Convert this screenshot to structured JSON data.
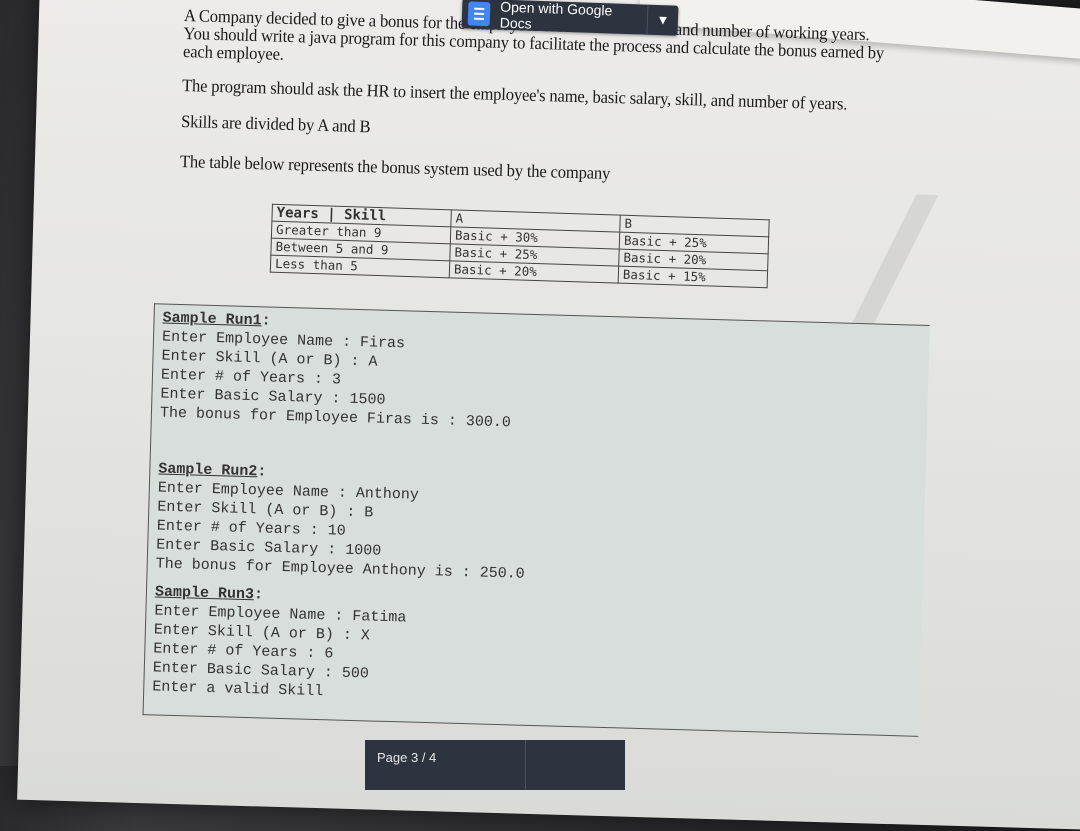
{
  "viewer": {
    "open_with_label": "Open with Google Docs",
    "open_with_icon": "google-docs-icon",
    "dropdown_icon": "chevron-down-icon",
    "page_indicator": "Page  3  /  4"
  },
  "document": {
    "paragraphs": [
      "A Company decided to give a bonus for the employees based on their skills and number of working years.",
      "You should write a java program for this company to facilitate the process and calculate the bonus earned by",
      "each employee.",
      "The program should ask the HR to insert the employee's name, basic salary, skill, and number of years.",
      "Skills are divided by A and B",
      "The table below represents the bonus system used by the company"
    ],
    "table": {
      "headers": [
        "Years | Skill",
        "A",
        "B"
      ],
      "rows": [
        [
          "Greater than 9",
          "Basic + 30%",
          "Basic + 25%"
        ],
        [
          "Between 5 and 9",
          "Basic + 25%",
          "Basic + 20%"
        ],
        [
          "Less than 5",
          "Basic + 20%",
          "Basic + 15%"
        ]
      ]
    },
    "sample_runs": [
      {
        "title": "Sample Run1:",
        "lines": [
          "Enter Employee Name : Firas",
          "Enter Skill (A or B) : A",
          "Enter # of Years : 3",
          "Enter Basic Salary : 1500",
          "The bonus for Employee Firas is : 300.0"
        ]
      },
      {
        "title": "Sample Run2:",
        "lines": [
          "Enter Employee Name : Anthony",
          "Enter Skill (A or B) : B",
          "Enter # of Years : 10",
          "Enter Basic Salary : 1000",
          "The bonus for Employee Anthony is : 250.0"
        ]
      },
      {
        "title": "Sample Run3:",
        "lines": [
          "Enter Employee Name : Fatima",
          "Enter Skill (A or B) : X",
          "Enter # of Years : 6",
          "Enter Basic Salary : 500",
          "Enter a valid Skill"
        ]
      }
    ]
  }
}
